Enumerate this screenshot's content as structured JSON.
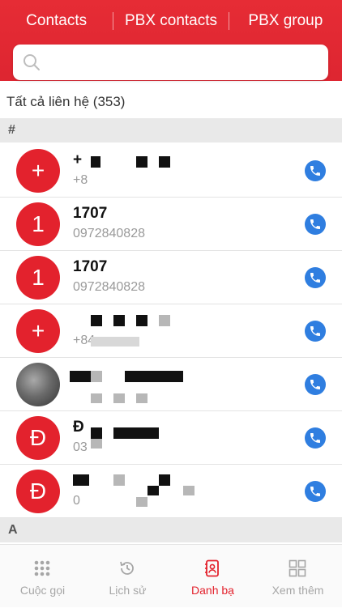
{
  "header": {
    "tabs": [
      "Contacts",
      "PBX contacts",
      "PBX group"
    ]
  },
  "search": {
    "placeholder": "",
    "value": ""
  },
  "summary": {
    "all_contacts": "Tất cả liên hệ (353)"
  },
  "sections": {
    "hash": "#",
    "a": "A"
  },
  "contacts": [
    {
      "avatar": "+",
      "name": "+",
      "phone": "+8"
    },
    {
      "avatar": "1",
      "name": "1707",
      "phone": "0972840828"
    },
    {
      "avatar": "1",
      "name": "1707",
      "phone": "0972840828"
    },
    {
      "avatar": "+",
      "name": "",
      "phone": "+84"
    },
    {
      "avatar": "",
      "name": "",
      "phone": ""
    },
    {
      "avatar": "Đ",
      "name": "Đ",
      "phone": "03"
    },
    {
      "avatar": "Đ",
      "name": "",
      "phone": "0"
    }
  ],
  "nav": [
    {
      "label": "Cuộc gọi",
      "icon": "dialpad-icon"
    },
    {
      "label": "Lịch sử",
      "icon": "history-icon"
    },
    {
      "label": "Danh bạ",
      "icon": "contacts-book-icon",
      "active": true
    },
    {
      "label": "Xem thêm",
      "icon": "more-grid-icon"
    }
  ],
  "colors": {
    "brand": "#e3222d",
    "call": "#2f7ee0"
  }
}
